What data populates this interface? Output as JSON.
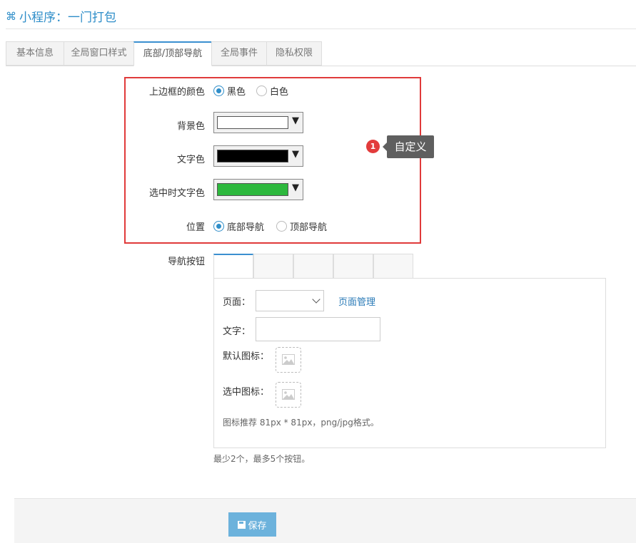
{
  "header": {
    "icon": "command-icon",
    "title": "小程序：一门打包"
  },
  "tabs": [
    {
      "label": "基本信息",
      "active": false
    },
    {
      "label": "全局窗口样式",
      "active": false
    },
    {
      "label": "底部/顶部导航",
      "active": true
    },
    {
      "label": "全局事件",
      "active": false
    },
    {
      "label": "隐私权限",
      "active": false
    }
  ],
  "form": {
    "border_color": {
      "label": "上边框的颜色",
      "options": [
        "黑色",
        "白色"
      ],
      "selected": "黑色"
    },
    "background_color": {
      "label": "背景色",
      "value": "#ffffff"
    },
    "text_color": {
      "label": "文字色",
      "value": "#000000"
    },
    "selected_text_color": {
      "label": "选中时文字色",
      "value": "#2db83d"
    },
    "position": {
      "label": "位置",
      "options": [
        "底部导航",
        "顶部导航"
      ],
      "selected": "底部导航"
    },
    "nav_buttons": {
      "label": "导航按钮",
      "page_label": "页面：",
      "page_manage_link": "页面管理",
      "text_label": "文字：",
      "default_icon_label": "默认图标：",
      "selected_icon_label": "选中图标：",
      "icon_hint": "图标推荐 81px * 81px，png/jpg格式。",
      "limit_hint": "最少2个，最多5个按钮。"
    }
  },
  "annotation": {
    "badge": "1",
    "tooltip": "自定义",
    "highlight_color": "#e03a3a"
  },
  "footer": {
    "save_label": "保存"
  }
}
